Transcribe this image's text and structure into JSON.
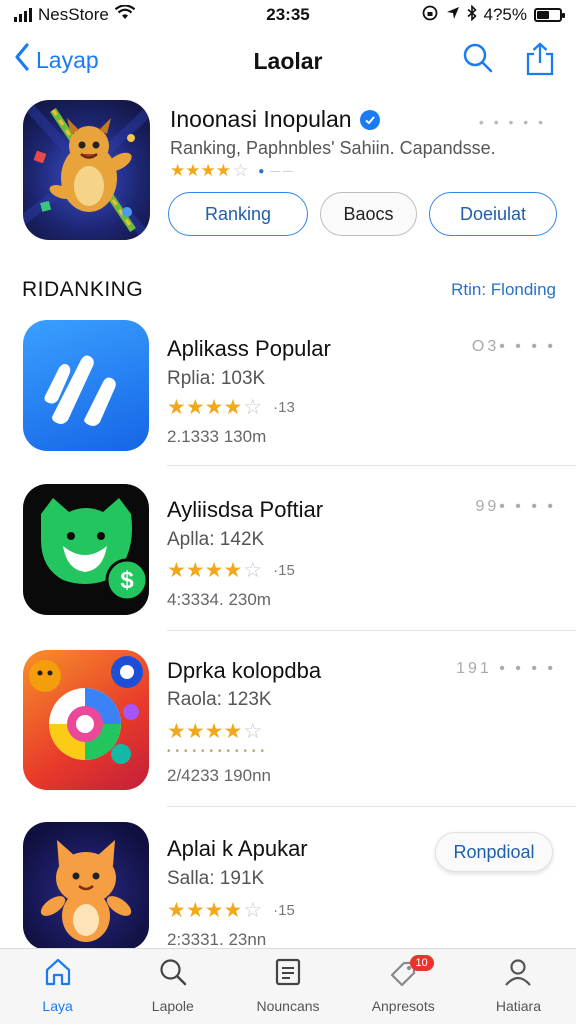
{
  "status_bar": {
    "carrier": "NesStore",
    "time": "23:35",
    "battery": "4?5%",
    "icons": [
      "signal-icon",
      "wifi-icon",
      "screen-lock-icon",
      "location-icon",
      "bluetooth-icon",
      "battery-icon"
    ]
  },
  "nav": {
    "back_label": "Layap",
    "title": "Laolar",
    "icons": [
      "chevron-left-icon",
      "search-icon",
      "share-icon"
    ]
  },
  "featured": {
    "title": "Inoonasi Inopulan",
    "subtitle": "Ranking, Paphnbles' Sahiin. Capandsse.",
    "dots": "• • • • •",
    "rating_stars": 4,
    "buttons": {
      "ranking": "Ranking",
      "basics": "Baocs",
      "download": "Doeiulat"
    }
  },
  "section": {
    "title": "RIDANKING",
    "link": "Rtin: Flonding"
  },
  "apps": [
    {
      "name": "Aplikass Popular",
      "rating": "Rplia: 103K",
      "stars": 4,
      "count": "·13",
      "meta": "2.1333  130m",
      "dots": "O3• • • •",
      "icon": "blue-app-icon"
    },
    {
      "name": "Ayliisdsa Poftiar",
      "rating": "Aplla: 142K",
      "stars": 4,
      "count": "·15",
      "meta": "4:3334. 230m",
      "dots": "99• • • •",
      "icon": "green-cat-icon"
    },
    {
      "name": "Dprka kolopdba",
      "rating": "Raola: 123K",
      "stars": 4,
      "count": "",
      "meta": "2/4233  190nn",
      "dots": "191 • • • •",
      "icon": "colorful-map-icon"
    },
    {
      "name": "Aplai k Apukar",
      "rating": "Salla: 191K",
      "stars": 4,
      "count": "·15",
      "meta": "2:3331. 23nn",
      "button": "Ronpdioal",
      "icon": "fox-app-icon"
    }
  ],
  "tabs": [
    {
      "label": "Laya",
      "icon": "home-icon",
      "active": true
    },
    {
      "label": "Lapole",
      "icon": "search-icon",
      "active": false
    },
    {
      "label": "Nouncans",
      "icon": "document-icon",
      "active": false
    },
    {
      "label": "Anpresots",
      "icon": "tag-icon",
      "active": false,
      "badge": "10"
    },
    {
      "label": "Hatiara",
      "icon": "person-icon",
      "active": false
    }
  ],
  "colors": {
    "accent": "#1a7cf3",
    "star": "#f2a81c",
    "badge": "#e6362c"
  }
}
